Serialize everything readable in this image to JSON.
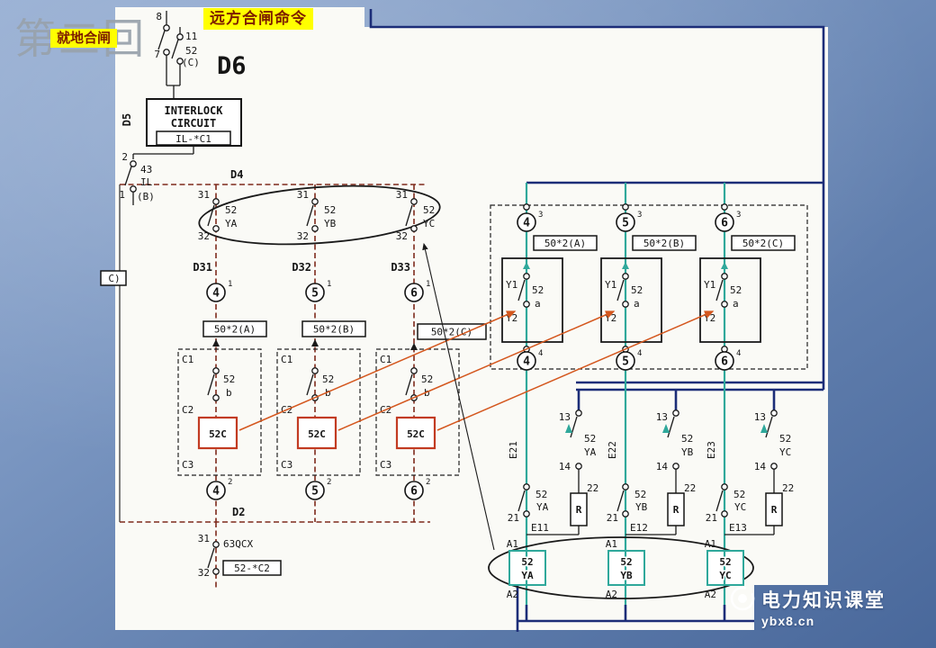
{
  "slide": {
    "title": "第二回",
    "labels": {
      "local_close": "就地合闸",
      "remote_close": "远方合闸命令"
    },
    "watermark": {
      "brand": "电力知识课堂",
      "site": "ybx8.cn"
    }
  },
  "top": {
    "t8": "8",
    "t7": "7",
    "t11": "11",
    "tC": "(C)",
    "d6": "D6",
    "d5": "D5",
    "d4": "D4",
    "d2": "D2",
    "interlock1": "INTERLOCK",
    "interlock2": "CIRCUIT",
    "interlock_tag": "IL-*C1",
    "t2": "2",
    "t1": "1",
    "t43": "43",
    "tIL": "IL",
    "tB": "(B)"
  },
  "bus": {
    "d31": "D31",
    "d32": "D32",
    "d33": "D33"
  },
  "common": {
    "n31": "31",
    "n32": "32",
    "n52": "52",
    "a": "a",
    "b": "b",
    "n13": "13",
    "n14": "14",
    "n21": "21",
    "n22": "22",
    "c4": "4",
    "c5": "5",
    "c6": "6",
    "s1": "1",
    "s2": "2",
    "s3": "3",
    "s4": "4",
    "ya": "YA",
    "yb": "YB",
    "yc": "YC",
    "y1": "Y1",
    "y2": "Y2",
    "r": "R",
    "c1": "C1",
    "c2": "C2",
    "c3": "C3",
    "b52c": "52C",
    "a1": "A1",
    "a2": "A2"
  },
  "boxes": {
    "b50a": "50*2(A)",
    "b50b": "50*2(B)",
    "b50c": "50*2(C)",
    "b63": "63QCX",
    "b52c2": "52-*C2",
    "partial_c": "C)"
  },
  "terminals": {
    "e11": "E11",
    "e12": "E12",
    "e13": "E13",
    "e21": "E21",
    "e22": "E22",
    "e23": "E23"
  },
  "colors": {
    "teal": "#2fa89b",
    "navy": "#1c2d78",
    "arrow_orange": "#d4571e",
    "bus_red": "#7e2a1c",
    "highlight_yellow": "#ffff00",
    "relay_box_red": "#c23b22"
  }
}
